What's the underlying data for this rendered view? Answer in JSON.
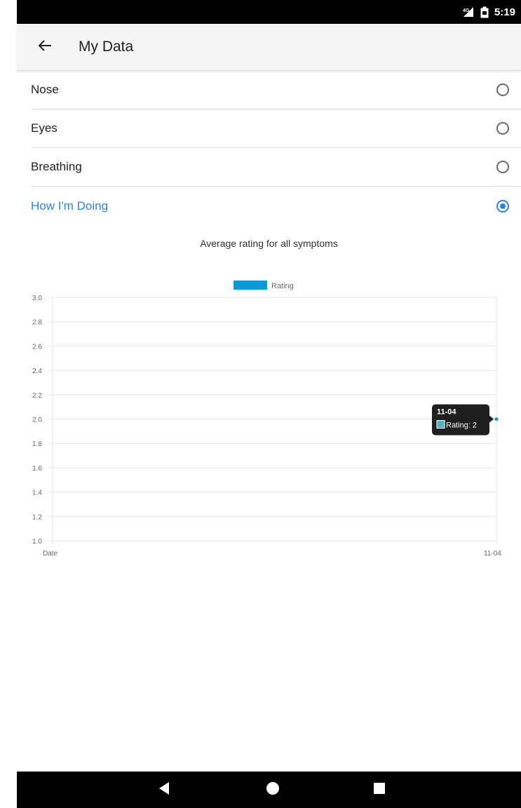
{
  "status_bar": {
    "time": "5:19",
    "icons": [
      "signal-icon",
      "battery-icon"
    ]
  },
  "app_bar": {
    "title": "My Data",
    "back_icon": "arrow-back-icon"
  },
  "options": [
    {
      "label": "Nose",
      "selected": false
    },
    {
      "label": "Eyes",
      "selected": false
    },
    {
      "label": "Breathing",
      "selected": false
    },
    {
      "label": "How I'm Doing",
      "selected": true
    }
  ],
  "colors": {
    "accent": "#2f80ed",
    "series": "#0a9ad8",
    "tooltip_bg": "#1f1f1f"
  },
  "chart_data": {
    "type": "line",
    "title": "Average rating for all symptoms",
    "legend": {
      "position": "top",
      "entries": [
        "Rating"
      ]
    },
    "x": [
      "11-04"
    ],
    "xlabel": "Date",
    "ylabel": "",
    "ylim": [
      1.0,
      3.0
    ],
    "yticks": [
      "3.0",
      "2.8",
      "2.6",
      "2.4",
      "2.2",
      "2.0",
      "1.8",
      "1.6",
      "1.4",
      "1.2",
      "1.0"
    ],
    "grid": true,
    "series": [
      {
        "name": "Rating",
        "values": [
          2
        ]
      }
    ],
    "tooltip": {
      "title": "11-04",
      "label": "Rating: 2"
    }
  },
  "nav_bar": {
    "buttons": [
      "back-triangle-icon",
      "home-circle-icon",
      "recents-square-icon"
    ]
  }
}
